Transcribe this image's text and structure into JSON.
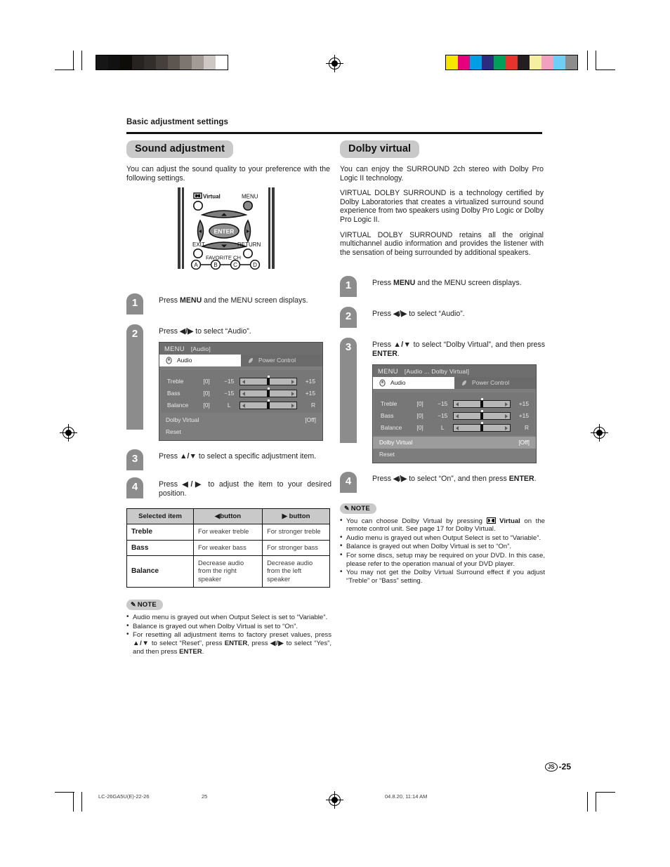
{
  "page": {
    "running_head": "Basic adjustment settings",
    "folio_mark": "JS",
    "folio_number": "-25",
    "footer_left": "LC-26GA5U(E)-22-26",
    "footer_center_page": "25",
    "footer_right": "04.8.20, 11:14 AM"
  },
  "print_bars": {
    "gray_scale": [
      "#161616",
      "#111111",
      "#0e0c09",
      "#262320",
      "#322e2b",
      "#45403c",
      "#5c5550",
      "#7d7670",
      "#a39c96",
      "#cdc8c3",
      "#ffffff"
    ],
    "color_patches": [
      "#f7e600",
      "#e6007e",
      "#009fe3",
      "#2b2b80",
      "#00a05a",
      "#e8322c",
      "#231f20",
      "#f6eea1",
      "#f2a0c0",
      "#6ecff6",
      "#8c8c8c"
    ]
  },
  "left_column": {
    "section_title": "Sound adjustment",
    "intro": "You can adjust the sound quality to your preference with the following settings.",
    "remote": {
      "virtual_label": "Virtual",
      "menu_label": "MENU",
      "enter_label": "ENTER",
      "exit_label": "EXIT",
      "return_label": "RETURN",
      "favorite_label": "FAVORITE CH",
      "color_buttons": [
        "A",
        "B",
        "C",
        "D"
      ]
    },
    "steps": [
      {
        "num": "1",
        "text_pre": "Press ",
        "bold": "MENU",
        "text_post": " and the MENU screen displays."
      },
      {
        "num": "2",
        "text_pre": "Press ",
        "bold": "◀/▶",
        "text_post": " to select “Audio”."
      },
      {
        "num": "3",
        "text_pre": "Press ",
        "bold": "▲/▼",
        "text_post": " to select a specific adjustment item."
      },
      {
        "num": "4",
        "text_pre": "Press ",
        "bold": "◀/▶",
        "text_post": " to adjust the item to your desired position."
      }
    ],
    "osd": {
      "menu_word": "MENU",
      "breadcrumb": "[Audio]",
      "tab_active": "Audio",
      "tab_inactive": "Power Control",
      "rows": [
        {
          "label": "Treble",
          "value": "[0]",
          "low": "−15",
          "high": "+15",
          "knob_pct": 50
        },
        {
          "label": "Bass",
          "value": "[0]",
          "low": "−15",
          "high": "+15",
          "knob_pct": 50
        },
        {
          "label": "Balance",
          "value": "[0]",
          "low": "L",
          "high": "R",
          "knob_pct": 50
        }
      ],
      "dolby_row_label": "Dolby Virtual",
      "dolby_row_value": "[Off]",
      "reset_row_label": "Reset",
      "dolby_row_selected": false
    },
    "table": {
      "headers": [
        "Selected item",
        "◀button",
        "▶ button"
      ],
      "rows": [
        [
          "Treble",
          "For weaker treble",
          "For stronger treble"
        ],
        [
          "Bass",
          "For weaker bass",
          "For stronger bass"
        ],
        [
          "Balance",
          "Decrease audio from the right speaker",
          "Decrease audio from the left speaker"
        ]
      ]
    },
    "note": {
      "label": "NOTE",
      "items": [
        "Audio menu is grayed out when Output Select is set to “Variable”.",
        "Balance is grayed out when Dolby Virtual is set to “On”.",
        "For resetting all adjustment items to factory preset values, press ▲/▼ to select “Reset”, press ENTER, press ◀/▶ to select “Yes”, and then press ENTER."
      ]
    }
  },
  "right_column": {
    "section_title": "Dolby virtual",
    "paragraphs": [
      "You can enjoy the SURROUND 2ch stereo with Dolby Pro Logic II technology.",
      "VIRTUAL DOLBY SURROUND is a technology certified by Dolby Laboratories that creates a virtualized surround sound experience from two speakers using Dolby Pro Logic or Dolby Pro Logic II.",
      "VIRTUAL DOLBY SURROUND retains all the original multichannel audio information and provides the listener with the sensation of being surrounded by additional speakers."
    ],
    "steps": [
      {
        "num": "1",
        "text_pre": "Press ",
        "bold": "MENU",
        "text_post": " and the MENU screen displays."
      },
      {
        "num": "2",
        "text_pre": "Press ",
        "bold": "◀/▶",
        "text_post": " to select “Audio”."
      },
      {
        "num": "3",
        "text_pre": "Press ",
        "bold": "▲/▼",
        "text_post": " to select “Dolby Virtual”, and then press ",
        "bold2": "ENTER",
        "text_end": "."
      },
      {
        "num": "4",
        "text_pre": "Press ",
        "bold": "◀/▶",
        "text_post": " to select “On”, and then press ",
        "bold2": "ENTER",
        "text_end": "."
      }
    ],
    "osd": {
      "menu_word": "MENU",
      "breadcrumb": "[Audio ... Dolby Virtual]",
      "tab_active": "Audio",
      "tab_inactive": "Power Control",
      "rows": [
        {
          "label": "Treble",
          "value": "[0]",
          "low": "−15",
          "high": "+15",
          "knob_pct": 50
        },
        {
          "label": "Bass",
          "value": "[0]",
          "low": "−15",
          "high": "+15",
          "knob_pct": 50
        },
        {
          "label": "Balance",
          "value": "[0]",
          "low": "L",
          "high": "R",
          "knob_pct": 50
        }
      ],
      "dolby_row_label": "Dolby Virtual",
      "dolby_row_value": "[Off]",
      "reset_row_label": "Reset",
      "dolby_row_selected": true
    },
    "note": {
      "label": "NOTE",
      "items": [
        "You can choose Dolby Virtual by pressing □□ Virtual on the remote control unit. See page 17 for Dolby Virtual.",
        "Audio menu is grayed out when Output Select is set to “Variable”.",
        "Balance is grayed out when Dolby Virtual is set to “On”.",
        "For some discs, setup may be required on your DVD. In this case, please refer to the operation manual of your DVD player.",
        "You may not get the Dolby Virtual Surround effect if you adjust “Treble” or “Bass” setting."
      ]
    }
  }
}
